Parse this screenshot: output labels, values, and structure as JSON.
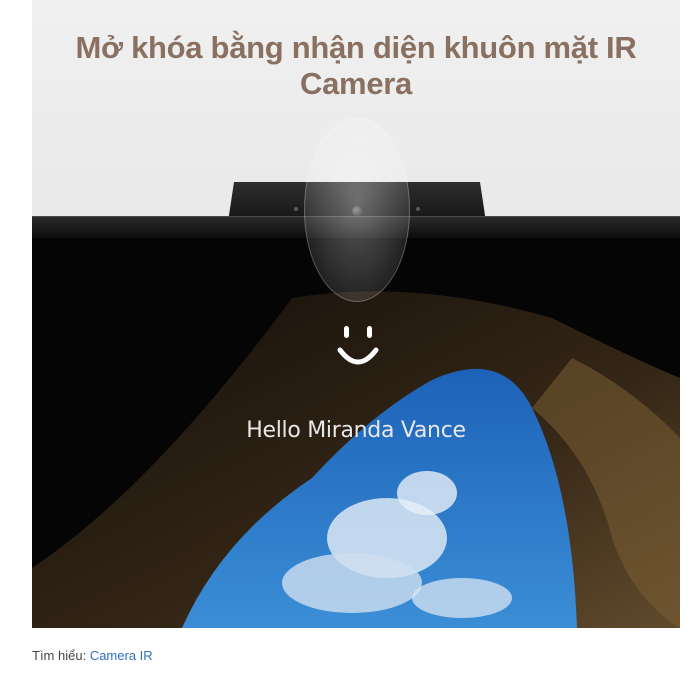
{
  "banner": {
    "title": "Mở khóa bằng nhận diện khuôn mặt IR Camera",
    "greeting": "Hello Miranda Vance",
    "icons": [
      "ir-camera-lens-icon",
      "smiley-face-icon"
    ]
  },
  "footer": {
    "prefix": "Tìm hiểu:",
    "link_label": "Camera IR"
  },
  "colors": {
    "title": "#8a7060",
    "link": "#2f6fc0"
  }
}
